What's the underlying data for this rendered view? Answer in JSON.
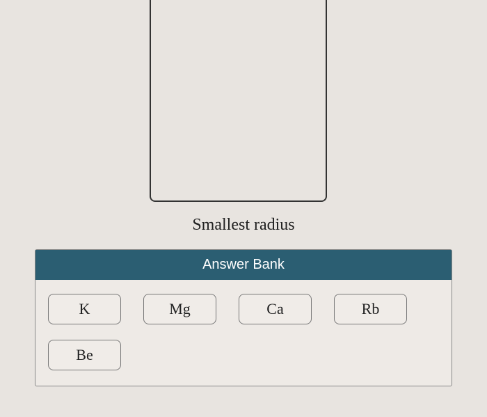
{
  "dropzone": {
    "label": "Smallest radius"
  },
  "answer_bank": {
    "title": "Answer Bank",
    "options": [
      "K",
      "Mg",
      "Ca",
      "Rb",
      "Be"
    ]
  }
}
